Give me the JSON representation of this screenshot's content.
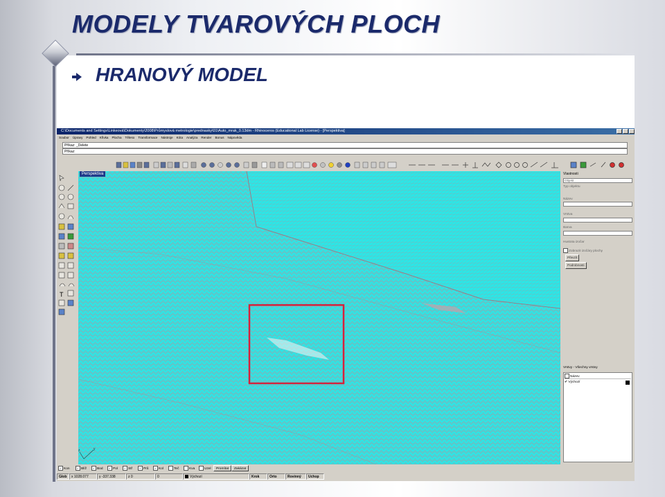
{
  "slide": {
    "title": "MODELY TVAROVÝCH PLOCH",
    "subtitle": "HRANOVÝ MODEL"
  },
  "window": {
    "title": "C:\\Documents and Settings\\Linkeová\\Dokumenty\\2008\\Průmyslová metrologie\\prednasky\\01\\Auto_mrak_0.13dm - Rhinoceros (Educational Lab License) - [Perspektiva]"
  },
  "menu": [
    "Soubor",
    "Úpravy",
    "Pohled",
    "Křivka",
    "Plocha",
    "Těleso",
    "Transformace",
    "Nástroje",
    "Kóta",
    "Analýza",
    "Render",
    "Bonus",
    "Nápověda"
  ],
  "command": {
    "history": "Příkaz: _Delete",
    "prompt": "Příkaz:"
  },
  "viewport": {
    "label": "Perspektiva",
    "mesh_color": "#2ce6e6",
    "edge_color": "#c08a92",
    "highlight_color": "#d8203a"
  },
  "properties": {
    "header": "Vlastnosti",
    "object_type": "Objekt",
    "items": [
      "Typ objektu",
      "Název",
      "Vrstva",
      "Barva",
      "Hustota izočar",
      "Zobrazit izočáry plochy"
    ],
    "buttons": [
      "Převzít",
      "Podrobnosti"
    ]
  },
  "layers": {
    "header": "Vrstvy - Všechny vrstvy",
    "column": "Název",
    "rows": [
      {
        "name": "Výchozí",
        "checked": true
      }
    ]
  },
  "osnaps": [
    {
      "label": "Kon",
      "checked": true
    },
    {
      "label": "Blíž",
      "checked": true
    },
    {
      "label": "Bod",
      "checked": true
    },
    {
      "label": "Pol",
      "checked": true
    },
    {
      "label": "Stř",
      "checked": true
    },
    {
      "label": "Prů",
      "checked": true
    },
    {
      "label": "Kol",
      "checked": true
    },
    {
      "label": "Teč",
      "checked": false
    },
    {
      "label": "Kva",
      "checked": false
    },
    {
      "label": "Uzel",
      "checked": false
    }
  ],
  "osnap_buttons": [
    "Promítat",
    "Zakázat"
  ],
  "status": {
    "cplane": "Glob",
    "x": "x 1028.077",
    "y": "y -337.338",
    "z": "z 0",
    "extra": "0",
    "layer": "Výchozí",
    "modes": [
      "Krok",
      "Orto",
      "Rovinný",
      "Uchop"
    ]
  }
}
